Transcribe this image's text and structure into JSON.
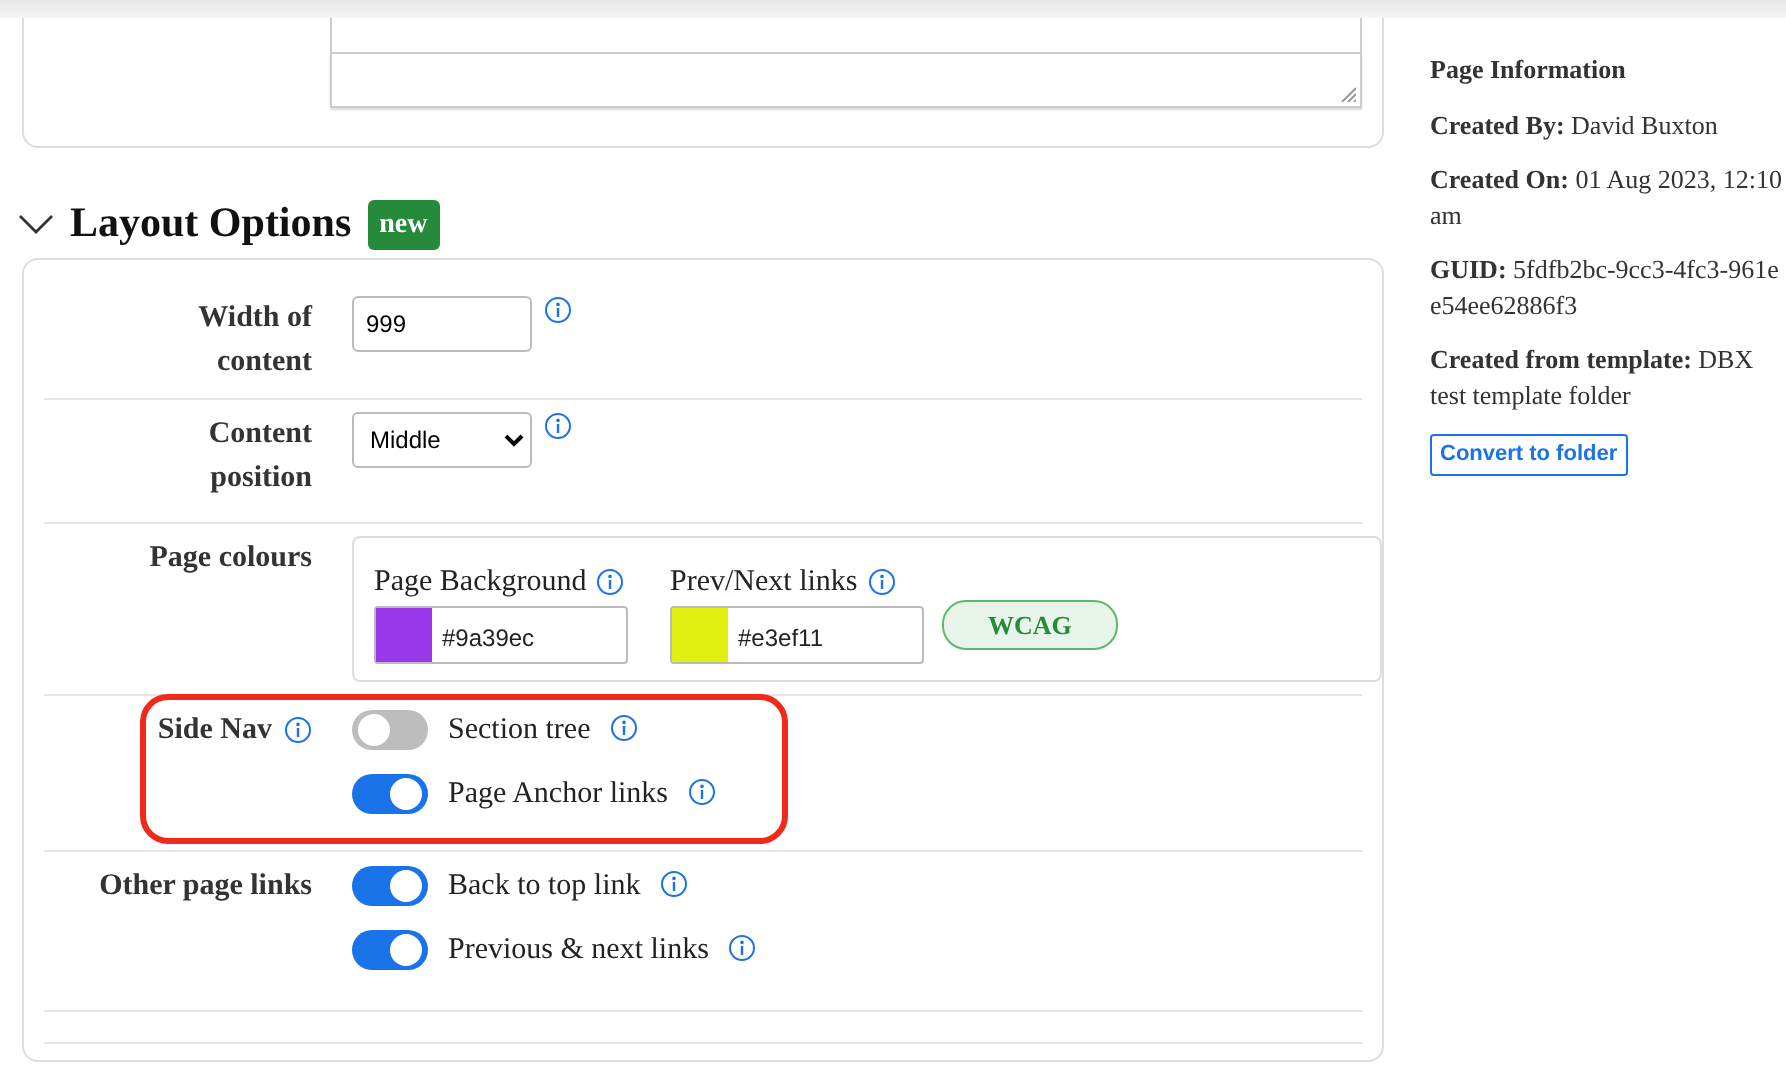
{
  "section": {
    "title": "Layout Options",
    "badge": "new",
    "expanded": true
  },
  "fields": [
    {
      "kind": "text",
      "label": "Width of content",
      "value": "999"
    },
    {
      "kind": "select",
      "label": "Content position",
      "value": "Middle"
    },
    {
      "kind": "colours",
      "label": "Page colours",
      "colours": [
        {
          "label": "Page Background",
          "value": "#9a39ec",
          "color": "#9a39ec"
        },
        {
          "label": "Prev/Next links",
          "value": "#e3ef11",
          "color": "#e3ef11"
        }
      ],
      "button": "WCAG"
    },
    {
      "kind": "toggles",
      "label": "Side Nav",
      "info": true,
      "highlighted": true,
      "toggles": [
        {
          "label": "Section tree",
          "on": false
        },
        {
          "label": "Page Anchor links",
          "on": true
        }
      ]
    },
    {
      "kind": "toggles",
      "label": "Other page links",
      "info": false,
      "highlighted": false,
      "toggles": [
        {
          "label": "Back to top link",
          "on": true
        },
        {
          "label": "Previous & next links",
          "on": true
        }
      ]
    }
  ],
  "page_information": {
    "title": "Page Information",
    "items": [
      {
        "label": "Created By:",
        "lines": [
          "David Buxton"
        ]
      },
      {
        "label": "Created On:",
        "lines": [
          "01 Aug 2023, 12:10",
          "am"
        ]
      },
      {
        "label": "GUID:",
        "lines": [
          "5fdfb2bc-9cc3-4fc3-961e",
          "e54ee62886f3"
        ]
      },
      {
        "label": "Created from template:",
        "lines": [
          "DBX",
          "test template folder"
        ]
      }
    ],
    "button": "Convert to folder"
  }
}
